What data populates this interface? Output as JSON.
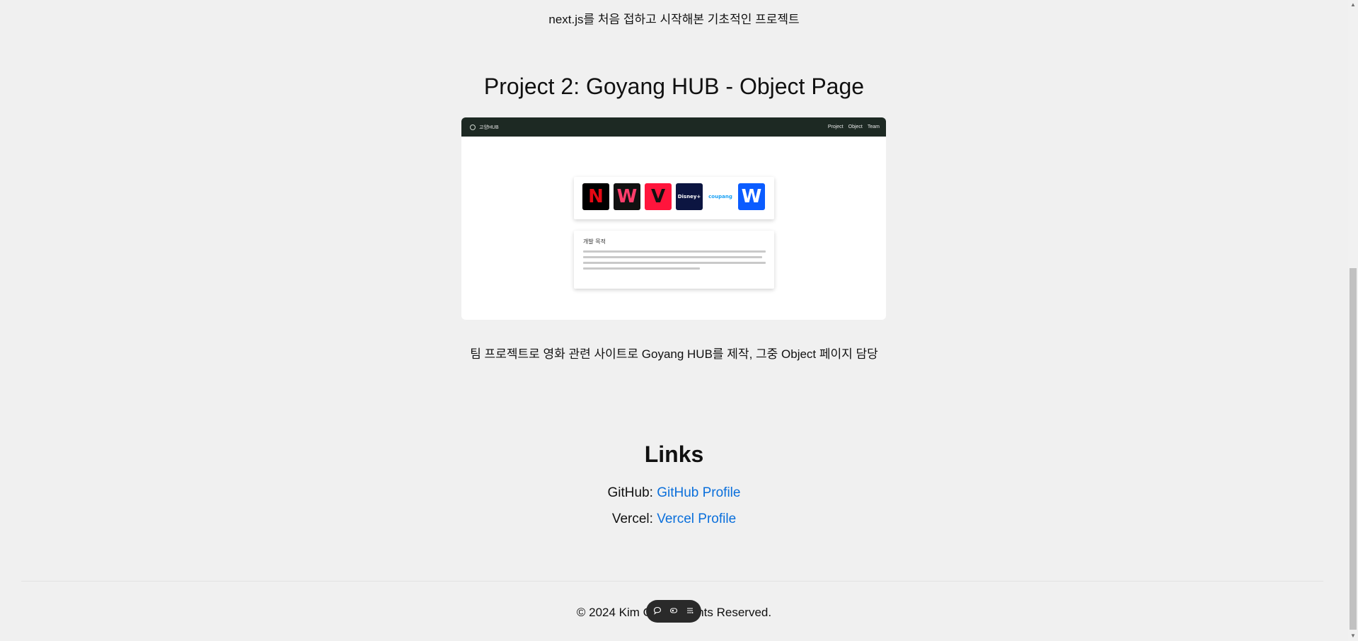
{
  "project1": {
    "description": "next.js를 처음 접하고 시작해본 기초적인 프로젝트"
  },
  "project2": {
    "title": "Project 2: Goyang HUB - Object Page",
    "description": "팀 프로젝트로 영화 관련 사이트로 Goyang HUB를 제작, 그중 Object 페이지 담당",
    "screenshot": {
      "brand": "고양HUB",
      "menu": [
        "Project",
        "Object",
        "Team"
      ],
      "ott_logos": [
        {
          "label": "N",
          "bg": "#000000",
          "fg": "#e50914"
        },
        {
          "label": "W",
          "bg": "#111111",
          "fg": "#ff3d6b"
        },
        {
          "label": "V",
          "bg": "#ff153c",
          "fg": "#111111"
        },
        {
          "label": "Disney+",
          "bg": "#0c1541",
          "fg": "#ffffff"
        },
        {
          "label": "coupang",
          "bg": "#ffffff",
          "fg": "#1aa1f4"
        },
        {
          "label": "W",
          "bg": "#0b5cff",
          "fg": "#ffffff"
        }
      ],
      "info_title": "개발 목적"
    }
  },
  "links": {
    "title": "Links",
    "github_label": "GitHub: ",
    "github_link": "GitHub Profile",
    "vercel_label": "Vercel: ",
    "vercel_link": "Vercel Profile"
  },
  "footer": {
    "copyright": "© 2024 Kim Geo... Rights Reserved."
  },
  "toolbar": {
    "icons": [
      "comment-icon",
      "visibility-icon",
      "menu-icon"
    ]
  }
}
